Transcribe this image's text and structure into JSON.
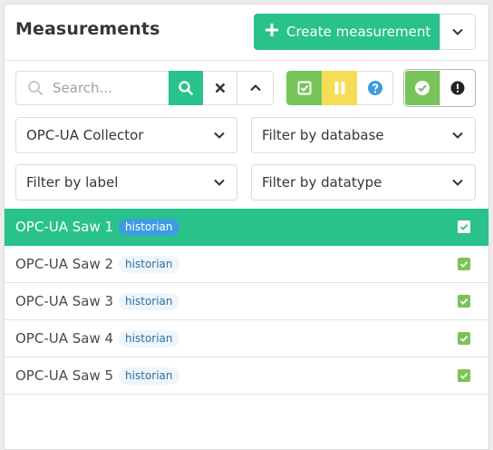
{
  "header": {
    "title": "Measurements",
    "create_label": "Create measurement",
    "create_icon": "plus-icon"
  },
  "toolbar": {
    "search_placeholder": "Search...",
    "search_value": ""
  },
  "filters": {
    "collector": "OPC-UA Collector",
    "database": "Filter by database",
    "label": "Filter by label",
    "datatype": "Filter by datatype"
  },
  "colors": {
    "primary": "#29c28a",
    "success": "#78c45a",
    "warning": "#f5dd58",
    "info": "#3d9de0"
  },
  "measurements": [
    {
      "name": "OPC-UA Saw 1",
      "tag": "historian",
      "checked": true,
      "selected": true
    },
    {
      "name": "OPC-UA Saw 2",
      "tag": "historian",
      "checked": true,
      "selected": false
    },
    {
      "name": "OPC-UA Saw 3",
      "tag": "historian",
      "checked": true,
      "selected": false
    },
    {
      "name": "OPC-UA Saw 4",
      "tag": "historian",
      "checked": true,
      "selected": false
    },
    {
      "name": "OPC-UA Saw 5",
      "tag": "historian",
      "checked": true,
      "selected": false
    }
  ]
}
